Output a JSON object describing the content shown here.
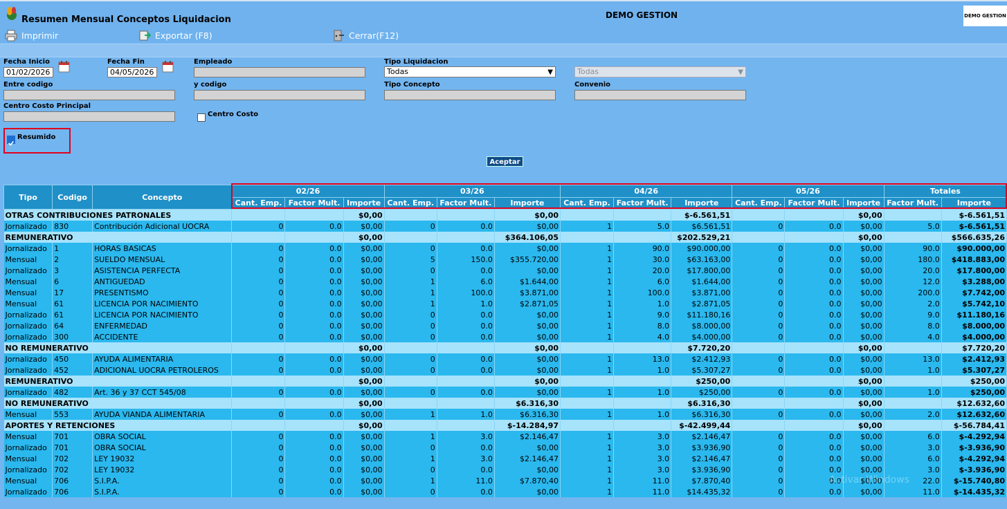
{
  "window": {
    "title": "Resumen Mensual Conceptos Liquidacion",
    "center_title": "DEMO GESTION",
    "logo_text": "DEMO GESTION"
  },
  "toolbar": {
    "print_label": "Imprimir",
    "export_label": "Exportar (F8)",
    "close_label": "Cerrar(F12)"
  },
  "filters": {
    "fecha_inicio_label": "Fecha Inicio",
    "fecha_inicio_value": "01/02/2026",
    "fecha_fin_label": "Fecha Fin",
    "fecha_fin_value": "04/05/2026",
    "empleado_label": "Empleado",
    "empleado_value": "",
    "tipo_liquidacion_label": "Tipo Liquidacion",
    "tipo_liquidacion_value": "Todas",
    "second_select_value": "Todas",
    "entre_codigo_label": "Entre codigo",
    "y_codigo_label": "y codigo",
    "tipo_concepto_label": "Tipo Concepto",
    "convenio_label": "Convenio",
    "centro_costo_principal_label": "Centro Costo Principal",
    "centro_costo_label": "Centro Costo",
    "centro_costo_checked": false,
    "resumido_label": "Resumido",
    "resumido_checked": true,
    "accept_label": "Aceptar"
  },
  "table": {
    "headers": {
      "tipo": "Tipo",
      "codigo": "Codigo",
      "concepto": "Concepto"
    },
    "periods": [
      "02/26",
      "03/26",
      "04/26",
      "05/26"
    ],
    "totals_label": "Totales",
    "sub": {
      "cant": "Cant. Emp.",
      "factor": "Factor Mult.",
      "importe": "Importe"
    },
    "rows": [
      {
        "section": true,
        "label": "OTRAS CONTRIBUCIONES PATRONALES",
        "p": [
          "$0,00",
          "$0,00",
          "$-6.561,51",
          "$0,00"
        ],
        "total": "$-6.561,51"
      },
      {
        "tipo": "Jornalizado",
        "codigo": "830",
        "concepto": "Contribución Adicional UOCRA",
        "v": [
          [
            "0",
            "0.0",
            "$0,00"
          ],
          [
            "0",
            "0.0",
            "$0,00"
          ],
          [
            "1",
            "5.0",
            "$6.561,51"
          ],
          [
            "0",
            "0.0",
            "$0,00"
          ]
        ],
        "tf": "5.0",
        "ti": "$-6.561,51"
      },
      {
        "section": true,
        "label": "REMUNERATIVO",
        "p": [
          "$0,00",
          "$364.106,05",
          "$202.529,21",
          "$0,00"
        ],
        "total": "$566.635,26"
      },
      {
        "tipo": "Jornalizado",
        "codigo": "1",
        "concepto": "HORAS BASICAS",
        "v": [
          [
            "0",
            "0.0",
            "$0,00"
          ],
          [
            "0",
            "0.0",
            "$0,00"
          ],
          [
            "1",
            "90.0",
            "$90.000,00"
          ],
          [
            "0",
            "0.0",
            "$0,00"
          ]
        ],
        "tf": "90.0",
        "ti": "$90.000,00"
      },
      {
        "tipo": "Mensual",
        "codigo": "2",
        "concepto": "SUELDO MENSUAL",
        "v": [
          [
            "0",
            "0.0",
            "$0,00"
          ],
          [
            "5",
            "150.0",
            "$355.720,00"
          ],
          [
            "1",
            "30.0",
            "$63.163,00"
          ],
          [
            "0",
            "0.0",
            "$0,00"
          ]
        ],
        "tf": "180.0",
        "ti": "$418.883,00"
      },
      {
        "tipo": "Jornalizado",
        "codigo": "3",
        "concepto": "ASISTENCIA PERFECTA",
        "v": [
          [
            "0",
            "0.0",
            "$0,00"
          ],
          [
            "0",
            "0.0",
            "$0,00"
          ],
          [
            "1",
            "20.0",
            "$17.800,00"
          ],
          [
            "0",
            "0.0",
            "$0,00"
          ]
        ],
        "tf": "20.0",
        "ti": "$17.800,00"
      },
      {
        "tipo": "Mensual",
        "codigo": "6",
        "concepto": "ANTIGUEDAD",
        "v": [
          [
            "0",
            "0.0",
            "$0,00"
          ],
          [
            "1",
            "6.0",
            "$1.644,00"
          ],
          [
            "1",
            "6.0",
            "$1.644,00"
          ],
          [
            "0",
            "0.0",
            "$0,00"
          ]
        ],
        "tf": "12.0",
        "ti": "$3.288,00"
      },
      {
        "tipo": "Mensual",
        "codigo": "17",
        "concepto": "PRESENTISMO",
        "v": [
          [
            "0",
            "0.0",
            "$0,00"
          ],
          [
            "1",
            "100.0",
            "$3.871,00"
          ],
          [
            "1",
            "100.0",
            "$3.871,00"
          ],
          [
            "0",
            "0.0",
            "$0,00"
          ]
        ],
        "tf": "200.0",
        "ti": "$7.742,00"
      },
      {
        "tipo": "Mensual",
        "codigo": "61",
        "concepto": "LICENCIA POR NACIMIENTO",
        "v": [
          [
            "0",
            "0.0",
            "$0,00"
          ],
          [
            "1",
            "1.0",
            "$2.871,05"
          ],
          [
            "1",
            "1.0",
            "$2.871,05"
          ],
          [
            "0",
            "0.0",
            "$0,00"
          ]
        ],
        "tf": "2.0",
        "ti": "$5.742,10"
      },
      {
        "tipo": "Jornalizado",
        "codigo": "61",
        "concepto": "LICENCIA POR NACIMIENTO",
        "v": [
          [
            "0",
            "0.0",
            "$0,00"
          ],
          [
            "0",
            "0.0",
            "$0,00"
          ],
          [
            "1",
            "9.0",
            "$11.180,16"
          ],
          [
            "0",
            "0.0",
            "$0,00"
          ]
        ],
        "tf": "9.0",
        "ti": "$11.180,16"
      },
      {
        "tipo": "Jornalizado",
        "codigo": "64",
        "concepto": "ENFERMEDAD",
        "v": [
          [
            "0",
            "0.0",
            "$0,00"
          ],
          [
            "0",
            "0.0",
            "$0,00"
          ],
          [
            "1",
            "8.0",
            "$8.000,00"
          ],
          [
            "0",
            "0.0",
            "$0,00"
          ]
        ],
        "tf": "8.0",
        "ti": "$8.000,00"
      },
      {
        "tipo": "Jornalizado",
        "codigo": "300",
        "concepto": "ACCIDENTE",
        "v": [
          [
            "0",
            "0.0",
            "$0,00"
          ],
          [
            "0",
            "0.0",
            "$0,00"
          ],
          [
            "1",
            "4.0",
            "$4.000,00"
          ],
          [
            "0",
            "0.0",
            "$0,00"
          ]
        ],
        "tf": "4.0",
        "ti": "$4.000,00"
      },
      {
        "section": true,
        "label": "NO REMUNERATIVO",
        "p": [
          "$0,00",
          "$0,00",
          "$7.720,20",
          "$0,00"
        ],
        "total": "$7.720,20"
      },
      {
        "tipo": "Jornalizado",
        "codigo": "450",
        "concepto": "AYUDA ALIMENTARIA",
        "v": [
          [
            "0",
            "0.0",
            "$0,00"
          ],
          [
            "0",
            "0.0",
            "$0,00"
          ],
          [
            "1",
            "13.0",
            "$2.412,93"
          ],
          [
            "0",
            "0.0",
            "$0,00"
          ]
        ],
        "tf": "13.0",
        "ti": "$2.412,93"
      },
      {
        "tipo": "Jornalizado",
        "codigo": "452",
        "concepto": "ADICIONAL UOCRA PETROLEROS",
        "v": [
          [
            "0",
            "0.0",
            "$0,00"
          ],
          [
            "0",
            "0.0",
            "$0,00"
          ],
          [
            "1",
            "1.0",
            "$5.307,27"
          ],
          [
            "0",
            "0.0",
            "$0,00"
          ]
        ],
        "tf": "1.0",
        "ti": "$5.307,27"
      },
      {
        "section": true,
        "label": "REMUNERATIVO",
        "p": [
          "$0,00",
          "$0,00",
          "$250,00",
          "$0,00"
        ],
        "total": "$250,00"
      },
      {
        "tipo": "Jornalizado",
        "codigo": "482",
        "concepto": "Art. 36 y 37 CCT 545/08",
        "v": [
          [
            "0",
            "0.0",
            "$0,00"
          ],
          [
            "0",
            "0.0",
            "$0,00"
          ],
          [
            "1",
            "1.0",
            "$250,00"
          ],
          [
            "0",
            "0.0",
            "$0,00"
          ]
        ],
        "tf": "1.0",
        "ti": "$250,00"
      },
      {
        "section": true,
        "label": "NO REMUNERATIVO",
        "p": [
          "$0,00",
          "$6.316,30",
          "$6.316,30",
          "$0,00"
        ],
        "total": "$12.632,60"
      },
      {
        "tipo": "Mensual",
        "codigo": "553",
        "concepto": "AYUDA VIANDA ALIMENTARIA",
        "v": [
          [
            "0",
            "0.0",
            "$0,00"
          ],
          [
            "1",
            "1.0",
            "$6.316,30"
          ],
          [
            "1",
            "1.0",
            "$6.316,30"
          ],
          [
            "0",
            "0.0",
            "$0,00"
          ]
        ],
        "tf": "2.0",
        "ti": "$12.632,60"
      },
      {
        "section": true,
        "label": "APORTES Y RETENCIONES",
        "p": [
          "$0,00",
          "$-14.284,97",
          "$-42.499,44",
          "$0,00"
        ],
        "total": "$-56.784,41"
      },
      {
        "tipo": "Mensual",
        "codigo": "701",
        "concepto": "OBRA SOCIAL",
        "v": [
          [
            "0",
            "0.0",
            "$0,00"
          ],
          [
            "1",
            "3.0",
            "$2.146,47"
          ],
          [
            "1",
            "3.0",
            "$2.146,47"
          ],
          [
            "0",
            "0.0",
            "$0,00"
          ]
        ],
        "tf": "6.0",
        "ti": "$-4.292,94"
      },
      {
        "tipo": "Jornalizado",
        "codigo": "701",
        "concepto": "OBRA SOCIAL",
        "v": [
          [
            "0",
            "0.0",
            "$0,00"
          ],
          [
            "0",
            "0.0",
            "$0,00"
          ],
          [
            "1",
            "3.0",
            "$3.936,90"
          ],
          [
            "0",
            "0.0",
            "$0,00"
          ]
        ],
        "tf": "3.0",
        "ti": "$-3.936,90"
      },
      {
        "tipo": "Mensual",
        "codigo": "702",
        "concepto": "LEY 19032",
        "v": [
          [
            "0",
            "0.0",
            "$0,00"
          ],
          [
            "1",
            "3.0",
            "$2.146,47"
          ],
          [
            "1",
            "3.0",
            "$2.146,47"
          ],
          [
            "0",
            "0.0",
            "$0,00"
          ]
        ],
        "tf": "6.0",
        "ti": "$-4.292,94"
      },
      {
        "tipo": "Jornalizado",
        "codigo": "702",
        "concepto": "LEY 19032",
        "v": [
          [
            "0",
            "0.0",
            "$0,00"
          ],
          [
            "0",
            "0.0",
            "$0,00"
          ],
          [
            "1",
            "3.0",
            "$3.936,90"
          ],
          [
            "0",
            "0.0",
            "$0,00"
          ]
        ],
        "tf": "3.0",
        "ti": "$-3.936,90"
      },
      {
        "tipo": "Mensual",
        "codigo": "706",
        "concepto": "S.I.P.A.",
        "v": [
          [
            "0",
            "0.0",
            "$0,00"
          ],
          [
            "1",
            "11.0",
            "$7.870,40"
          ],
          [
            "1",
            "11.0",
            "$7.870,40"
          ],
          [
            "0",
            "0.0",
            "$0,00"
          ]
        ],
        "tf": "22.0",
        "ti": "$-15.740,80"
      },
      {
        "tipo": "Jornalizado",
        "codigo": "706",
        "concepto": "S.I.P.A.",
        "v": [
          [
            "0",
            "0.0",
            "$0,00"
          ],
          [
            "0",
            "0.0",
            "$0,00"
          ],
          [
            "1",
            "11.0",
            "$14.435,32"
          ],
          [
            "0",
            "0.0",
            "$0,00"
          ]
        ],
        "tf": "11.0",
        "ti": "$-14.435,32"
      }
    ]
  },
  "watermark": "Activar Windows"
}
